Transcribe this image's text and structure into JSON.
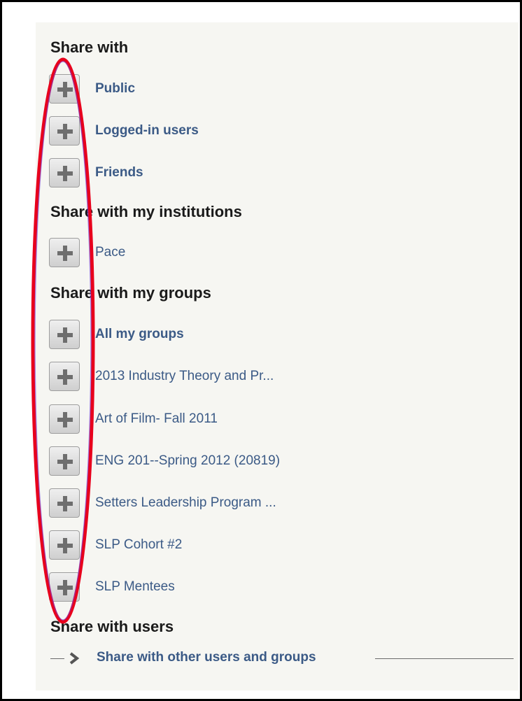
{
  "sections": {
    "share_with": "Share with",
    "institutions": "Share with my institutions",
    "groups": "Share with my groups",
    "users": "Share with users"
  },
  "share_with_items": [
    {
      "label": "Public"
    },
    {
      "label": "Logged-in users"
    },
    {
      "label": "Friends"
    }
  ],
  "institution_items": [
    {
      "label": "Pace"
    }
  ],
  "group_items": [
    {
      "label": "All my groups"
    },
    {
      "label": "2013 Industry Theory and Pr..."
    },
    {
      "label": "Art of Film- Fall 2011"
    },
    {
      "label": "ENG 201--Spring 2012 (20819)"
    },
    {
      "label": "Setters Leadership Program ..."
    },
    {
      "label": "SLP Cohort #2"
    },
    {
      "label": "SLP Mentees"
    }
  ],
  "share_other_link": "Share with other users and groups",
  "colors": {
    "link": "#3b5a86",
    "heading": "#1a1a1a",
    "highlight_ellipse": "#e8001c",
    "panel_bg": "#f6f6f2"
  },
  "icons": {
    "add": "plus-icon",
    "expand": "chevron-right-icon"
  }
}
